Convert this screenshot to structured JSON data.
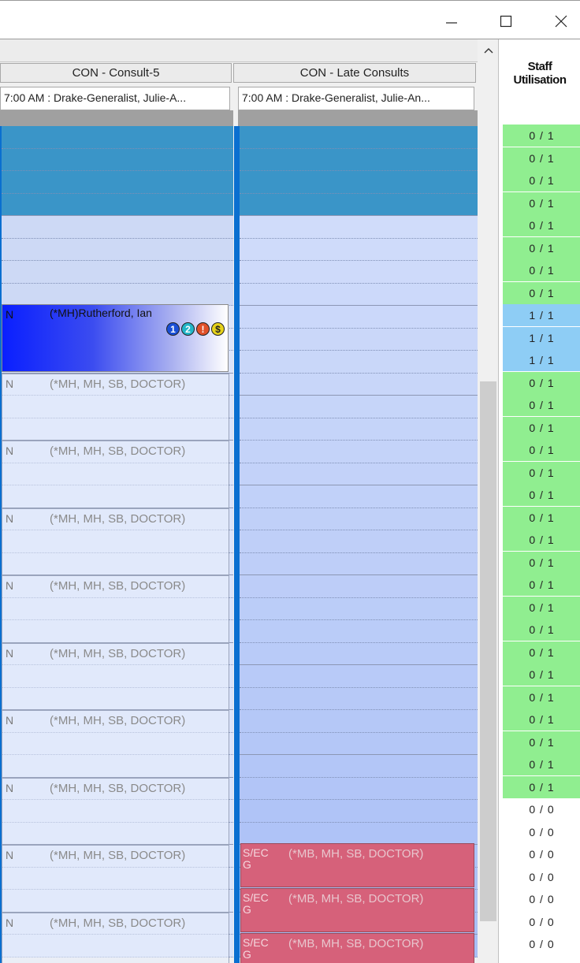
{
  "window": {
    "minimize_icon": "minimize-icon",
    "maximize_icon": "maximize-icon",
    "close_icon": "close-icon"
  },
  "columns": [
    {
      "title": "CON - Consult-5",
      "provider": "7:00 AM : Drake-Generalist, Julie-A..."
    },
    {
      "title": "CON - Late Consults",
      "provider": "7:00 AM : Drake-Generalist, Julie-An..."
    }
  ],
  "booked_appointment": {
    "code": "N",
    "patient": "(*MH)Rutherford, Ian",
    "badges": [
      "1",
      "2",
      "!",
      "$"
    ],
    "badge_colors": [
      "#1a4fd6",
      "#22b6c8",
      "#e0502a",
      "#e6d21a"
    ]
  },
  "open_slot": {
    "code": "N",
    "text": "(*MH, MH, SB, DOCTOR)"
  },
  "late_slot": {
    "code": "S/EC G",
    "text": "(*MB, MH, SB, DOCTOR)"
  },
  "staff_utilisation": {
    "header_line1": "Staff",
    "header_line2": "Utilisation",
    "rows": [
      "0 / 1",
      "0 / 1",
      "0 / 1",
      "0 / 1",
      "0 / 1",
      "0 / 1",
      "0 / 1",
      "0 / 1",
      "1 / 1",
      "1 / 1",
      "1 / 1",
      "0 / 1",
      "0 / 1",
      "0 / 1",
      "0 / 1",
      "0 / 1",
      "0 / 1",
      "0 / 1",
      "0 / 1",
      "0 / 1",
      "0 / 1",
      "0 / 1",
      "0 / 1",
      "0 / 1",
      "0 / 1",
      "0 / 1",
      "0 / 1",
      "0 / 1",
      "0 / 1",
      "0 / 1",
      "0 / 0",
      "0 / 0",
      "0 / 0",
      "0 / 0",
      "0 / 0",
      "0 / 0",
      "0 / 0"
    ],
    "row_colors": [
      "#90ee90",
      "#90ee90",
      "#90ee90",
      "#90ee90",
      "#90ee90",
      "#90ee90",
      "#90ee90",
      "#90ee90",
      "#8ecdf5",
      "#8ecdf5",
      "#8ecdf5",
      "#90ee90",
      "#90ee90",
      "#90ee90",
      "#90ee90",
      "#90ee90",
      "#90ee90",
      "#90ee90",
      "#90ee90",
      "#90ee90",
      "#90ee90",
      "#90ee90",
      "#90ee90",
      "#90ee90",
      "#90ee90",
      "#90ee90",
      "#90ee90",
      "#90ee90",
      "#90ee90",
      "#90ee90",
      "#ffffff",
      "#ffffff",
      "#ffffff",
      "#ffffff",
      "#ffffff",
      "#ffffff",
      "#ffffff"
    ]
  },
  "colors": {
    "blocked": "#3a95c8",
    "slot_light": "#d2dcf6",
    "late_column": "#b8c9f6",
    "divider": "#0a6fd0"
  }
}
